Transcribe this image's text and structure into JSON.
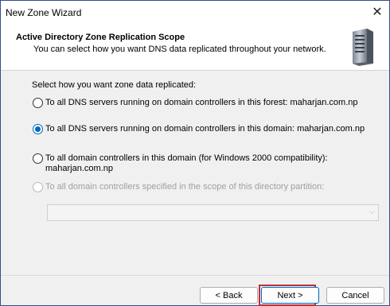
{
  "window": {
    "title": "New Zone Wizard",
    "close_glyph": "✕"
  },
  "header": {
    "title": "Active Directory Zone Replication Scope",
    "subtitle": "You can select how you want DNS data replicated throughout your network.",
    "icon": "server-icon"
  },
  "main": {
    "prompt": "Select how you want zone data replicated:",
    "options": [
      {
        "label": "To all DNS servers running on domain controllers in this forest: maharjan.com.np",
        "checked": false,
        "enabled": true
      },
      {
        "label": "To all DNS servers running on domain controllers in this domain: maharjan.com.np",
        "checked": true,
        "enabled": true
      },
      {
        "label": "To all domain controllers in this domain (for Windows 2000 compatibility):",
        "sub": "maharjan.com.np",
        "checked": false,
        "enabled": true
      },
      {
        "label": "To all domain controllers specified in the scope of this directory partition:",
        "checked": false,
        "enabled": false
      }
    ],
    "partition_combo": {
      "value": "",
      "enabled": false
    }
  },
  "footer": {
    "back_label": "< Back",
    "next_label": "Next >",
    "cancel_label": "Cancel"
  },
  "colors": {
    "accent": "#0067c0",
    "highlight": "#c0303a"
  }
}
